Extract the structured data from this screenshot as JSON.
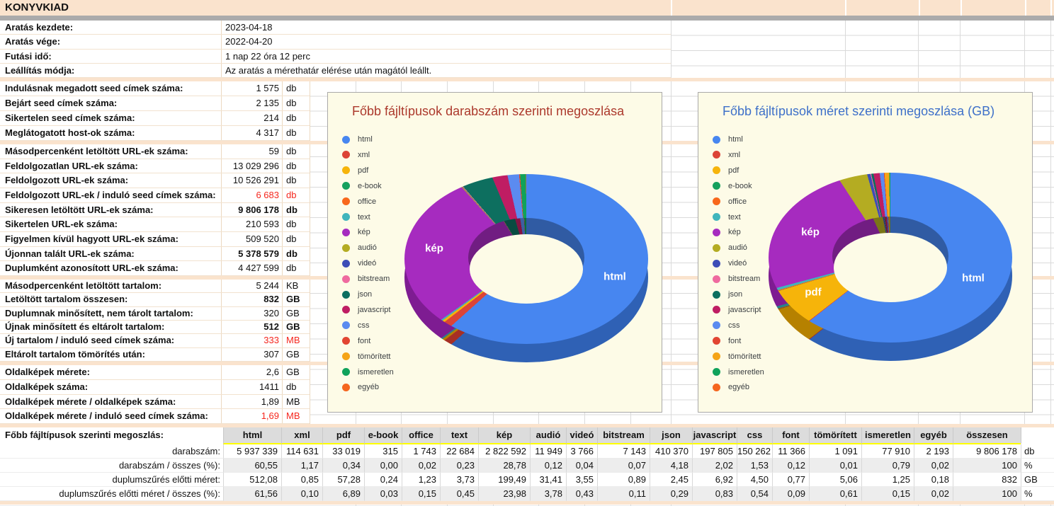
{
  "header": {
    "title": "KONYVKIAD"
  },
  "palette": {
    "categories": [
      "html",
      "xml",
      "pdf",
      "e-book",
      "office",
      "text",
      "kép",
      "audió",
      "videó",
      "bitstream",
      "json",
      "javascript",
      "css",
      "font",
      "tömörített",
      "ismeretlen",
      "egyéb"
    ],
    "colors": [
      "#4786f0",
      "#dc4437",
      "#f6b40a",
      "#16a15d",
      "#f8681c",
      "#40b5bc",
      "#a62bbf",
      "#b4ac22",
      "#3d4db7",
      "#ef6a9f",
      "#0d6f5f",
      "#bf1d63",
      "#5b8bf0",
      "#e24532",
      "#f5a417",
      "#10a25b",
      "#f5661f"
    ]
  },
  "stats_sections": [
    {
      "rows": [
        {
          "label": "Aratás kezdete:",
          "value": "2023-04-18",
          "unit": "",
          "style": ""
        },
        {
          "label": "Aratás vége:",
          "value": "2022-04-20",
          "unit": "",
          "style": ""
        },
        {
          "label": "Futási idő:",
          "value": "1 nap 22 óra 12 perc",
          "unit": "",
          "style": ""
        },
        {
          "label": "Leállítás módja:",
          "value": "Az aratás a mérethatár elérése után magától leállt.",
          "unit": "",
          "style": ""
        }
      ]
    },
    {
      "rows": [
        {
          "label": "Indulásnak megadott seed címek száma:",
          "value": "1 575",
          "unit": "db",
          "style": ""
        },
        {
          "label": "Bejárt seed címek száma:",
          "value": "2 135",
          "unit": "db",
          "style": ""
        },
        {
          "label": "Sikertelen seed címek száma:",
          "value": "214",
          "unit": "db",
          "style": ""
        },
        {
          "label": "Meglátogatott host-ok száma:",
          "value": "4 317",
          "unit": "db",
          "style": ""
        }
      ]
    },
    {
      "rows": [
        {
          "label": "Másodpercenként letöltött URL-ek száma:",
          "value": "59",
          "unit": "db",
          "style": ""
        },
        {
          "label": "Feldolgozatlan URL-ek száma:",
          "value": "13 029 296",
          "unit": "db",
          "style": ""
        },
        {
          "label": "Feldolgozott URL-ek száma:",
          "value": "10 526 291",
          "unit": "db",
          "style": ""
        },
        {
          "label": "Feldolgozott URL-ek / induló seed címek száma:",
          "value": "6 683",
          "unit": "db",
          "style": "red"
        },
        {
          "label": "Sikeresen letöltött URL-ek száma:",
          "value": "9 806 178",
          "unit": "db",
          "style": "bold"
        },
        {
          "label": "Sikertelen URL-ek száma:",
          "value": "210 593",
          "unit": "db",
          "style": ""
        },
        {
          "label": "Figyelmen kívül hagyott URL-ek száma:",
          "value": "509 520",
          "unit": "db",
          "style": ""
        },
        {
          "label": "Újonnan talált URL-ek száma:",
          "value": "5 378 579",
          "unit": "db",
          "style": "bold"
        },
        {
          "label": "Duplumként azonosított URL-ek száma:",
          "value": "4 427 599",
          "unit": "db",
          "style": ""
        }
      ]
    },
    {
      "rows": [
        {
          "label": "Másodpercenként letöltött tartalom:",
          "value": "5 244",
          "unit": "KB",
          "style": ""
        },
        {
          "label": "Letöltött tartalom összesen:",
          "value": "832",
          "unit": "GB",
          "style": "bold"
        },
        {
          "label": "Duplumnak minősített, nem tárolt tartalom:",
          "value": "320",
          "unit": "GB",
          "style": ""
        },
        {
          "label": "Újnak minősített és eltárolt tartalom:",
          "value": "512",
          "unit": "GB",
          "style": "bold"
        },
        {
          "label": "Új tartalom / induló seed címek száma:",
          "value": "333",
          "unit": "MB",
          "style": "red"
        },
        {
          "label": "Eltárolt tartalom tömörítés után:",
          "value": "307",
          "unit": "GB",
          "style": ""
        }
      ]
    },
    {
      "rows": [
        {
          "label": "Oldalképek mérete:",
          "value": "2,6",
          "unit": "GB",
          "style": ""
        },
        {
          "label": "Oldalképek száma:",
          "value": "1411",
          "unit": "db",
          "style": ""
        },
        {
          "label": "Oldalképek mérete  / oldalképek száma:",
          "value": "1,89",
          "unit": "MB",
          "style": ""
        },
        {
          "label": "Oldalképek mérete  / induló seed címek száma:",
          "value": "1,69",
          "unit": "MB",
          "style": "red"
        }
      ]
    }
  ],
  "chart_data": [
    {
      "type": "pie",
      "donut": true,
      "is3d": true,
      "title": "Főbb fájltípusok darabszám szerinti megoszlása",
      "title_color": "#ac392c",
      "legend_position": "left",
      "unit": "%",
      "categories": [
        "html",
        "xml",
        "pdf",
        "e-book",
        "office",
        "text",
        "kép",
        "audió",
        "videó",
        "bitstream",
        "json",
        "javascript",
        "css",
        "font",
        "tömörített",
        "ismeretlen",
        "egyéb"
      ],
      "values": [
        60.55,
        1.17,
        0.34,
        0.0,
        0.02,
        0.23,
        28.78,
        0.12,
        0.04,
        0.07,
        4.18,
        2.02,
        1.53,
        0.12,
        0.01,
        0.79,
        0.02
      ],
      "slice_labels": [
        "kép",
        "html"
      ]
    },
    {
      "type": "pie",
      "donut": true,
      "is3d": true,
      "title": "Főbb fájltípusok méret szerinti megoszlása (GB)",
      "title_color": "#3e70c9",
      "legend_position": "left",
      "unit": "%",
      "categories": [
        "html",
        "xml",
        "pdf",
        "e-book",
        "office",
        "text",
        "kép",
        "audió",
        "videó",
        "bitstream",
        "json",
        "javascript",
        "css",
        "font",
        "tömörített",
        "ismeretlen",
        "egyéb"
      ],
      "values": [
        61.56,
        0.1,
        6.89,
        0.03,
        0.15,
        0.45,
        23.98,
        3.78,
        0.43,
        0.11,
        0.29,
        0.83,
        0.54,
        0.09,
        0.61,
        0.15,
        0.02
      ],
      "slice_labels": [
        "kép",
        "pdf",
        "html"
      ]
    }
  ],
  "bottom_table": {
    "title": "Főbb fájltípusok szerinti megoszlás:",
    "columns": [
      "html",
      "xml",
      "pdf",
      "e-book",
      "office",
      "text",
      "kép",
      "audió",
      "videó",
      "bitstream",
      "json",
      "javascript",
      "css",
      "font",
      "tömörített",
      "ismeretlen",
      "egyéb",
      "összesen"
    ],
    "rows": [
      {
        "label": "darabszám:",
        "values": [
          "5 937 339",
          "114 631",
          "33 019",
          "315",
          "1 743",
          "22 684",
          "2 822 592",
          "11 949",
          "3 766",
          "7 143",
          "410 370",
          "197 805",
          "150 262",
          "11 366",
          "1 091",
          "77 910",
          "2 193",
          "9 806 178"
        ],
        "unit": "db"
      },
      {
        "label": "darabszám / összes (%):",
        "values": [
          "60,55",
          "1,17",
          "0,34",
          "0,00",
          "0,02",
          "0,23",
          "28,78",
          "0,12",
          "0,04",
          "0,07",
          "4,18",
          "2,02",
          "1,53",
          "0,12",
          "0,01",
          "0,79",
          "0,02",
          "100"
        ],
        "unit": "%"
      },
      {
        "label": "duplumszűrés előtti méret:",
        "values": [
          "512,08",
          "0,85",
          "57,28",
          "0,24",
          "1,23",
          "3,73",
          "199,49",
          "31,41",
          "3,55",
          "0,89",
          "2,45",
          "6,92",
          "4,50",
          "0,77",
          "5,06",
          "1,25",
          "0,18",
          "832"
        ],
        "unit": "GB"
      },
      {
        "label": "duplumszűrés előtti méret / összes (%):",
        "values": [
          "61,56",
          "0,10",
          "6,89",
          "0,03",
          "0,15",
          "0,45",
          "23,98",
          "3,78",
          "0,43",
          "0,11",
          "0,29",
          "0,83",
          "0,54",
          "0,09",
          "0,61",
          "0,15",
          "0,02",
          "100"
        ],
        "unit": "%"
      }
    ]
  },
  "colors": {
    "header_bg": "#fae3cd",
    "separator_bg": "#fae3cd",
    "gray_divider": "#ababab",
    "gridline": "#dadada",
    "panel_bg": "#fdfbe7",
    "table_header_bg": "#dcdcdc",
    "table_header_underline": "#ffff00",
    "alert_red": "#f5261d"
  }
}
